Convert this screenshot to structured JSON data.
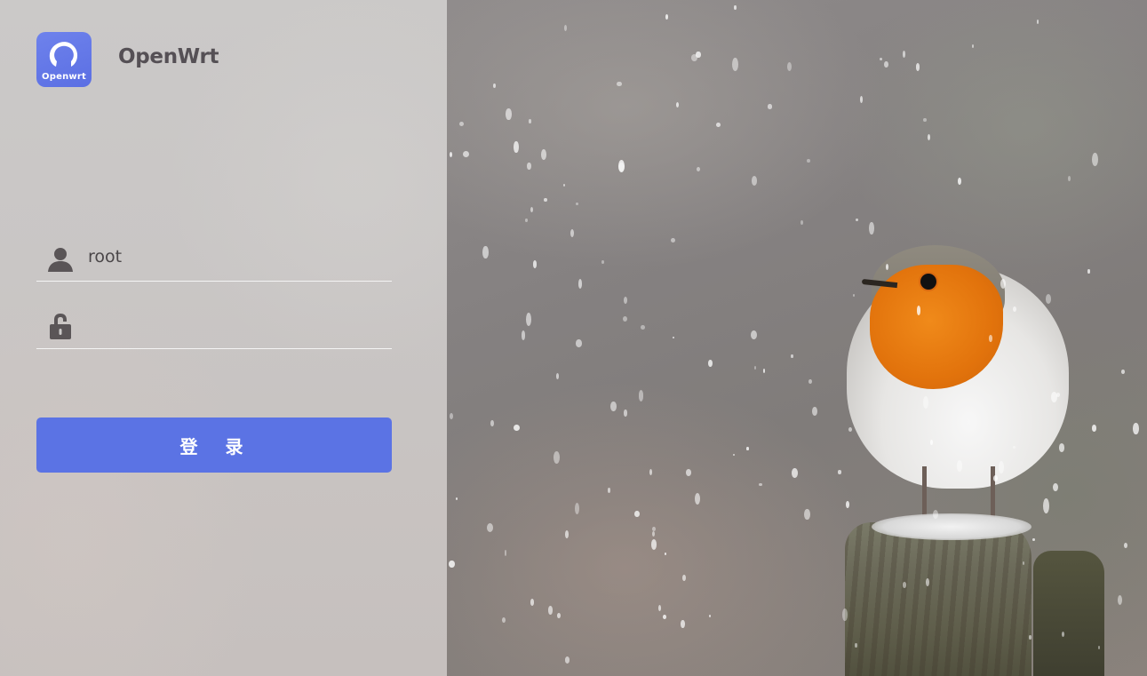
{
  "logo": {
    "badge_text": "Openwrt",
    "title": "OpenWrt"
  },
  "login_form": {
    "username": {
      "value": "root",
      "placeholder": "",
      "icon": "user-icon"
    },
    "password": {
      "value": "",
      "placeholder": "",
      "icon": "unlock-icon"
    },
    "submit_label": "登 录"
  },
  "background": {
    "subject": "robin-in-snow-photo"
  },
  "colors": {
    "accent": "#5b73e4",
    "logo_badge": "#5b6fe3",
    "icon_gray": "#5a5557"
  }
}
